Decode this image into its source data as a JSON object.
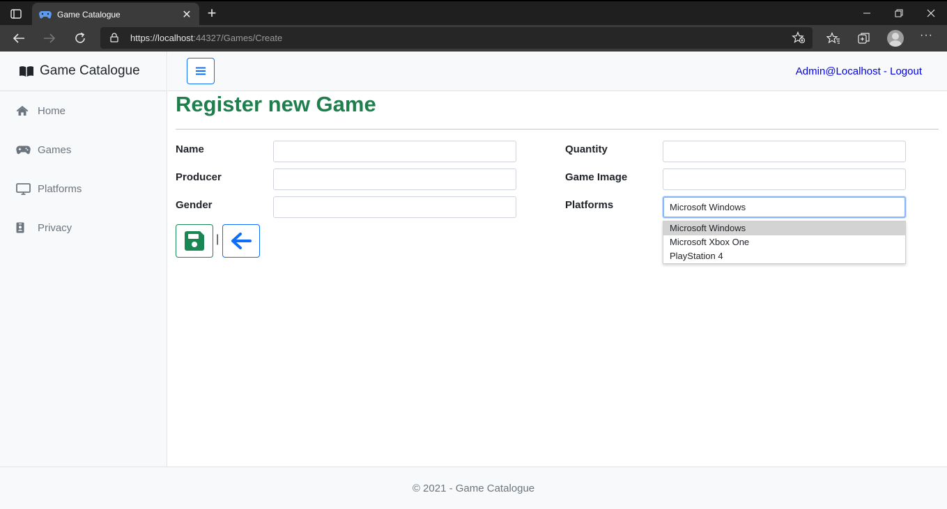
{
  "browser": {
    "tab_title": "Game Catalogue",
    "url_host": "https://localhost",
    "url_path": ":44327/Games/Create",
    "new_tab": "+",
    "tab_close": "✕"
  },
  "app": {
    "brand": "Game Catalogue",
    "user": "Admin@Localhost",
    "user_sep": " - ",
    "logout": "Logout"
  },
  "sidebar": {
    "items": [
      {
        "label": "Home",
        "icon": "home-icon"
      },
      {
        "label": "Games",
        "icon": "gamepad-icon"
      },
      {
        "label": "Platforms",
        "icon": "desktop-icon"
      },
      {
        "label": "Privacy",
        "icon": "id-badge-icon"
      }
    ]
  },
  "page": {
    "title": "Register new Game"
  },
  "form": {
    "name_label": "Name",
    "producer_label": "Producer",
    "gender_label": "Gender",
    "quantity_label": "Quantity",
    "image_label": "Game Image",
    "platforms_label": "Platforms",
    "name_value": "",
    "producer_value": "",
    "gender_value": "",
    "quantity_value": "",
    "image_value": "",
    "platforms_value": "Microsoft Windows",
    "separator": "|"
  },
  "platforms_dropdown": {
    "options": [
      "Microsoft Windows",
      "Microsoft Xbox One",
      "PlayStation 4"
    ],
    "highlighted_index": 0
  },
  "footer": {
    "text": "© 2021 - Game Catalogue"
  },
  "colors": {
    "title_green": "#1e7e4c",
    "save_green": "#198754",
    "primary_blue": "#0d6efd",
    "link_blue": "#0000ee"
  }
}
